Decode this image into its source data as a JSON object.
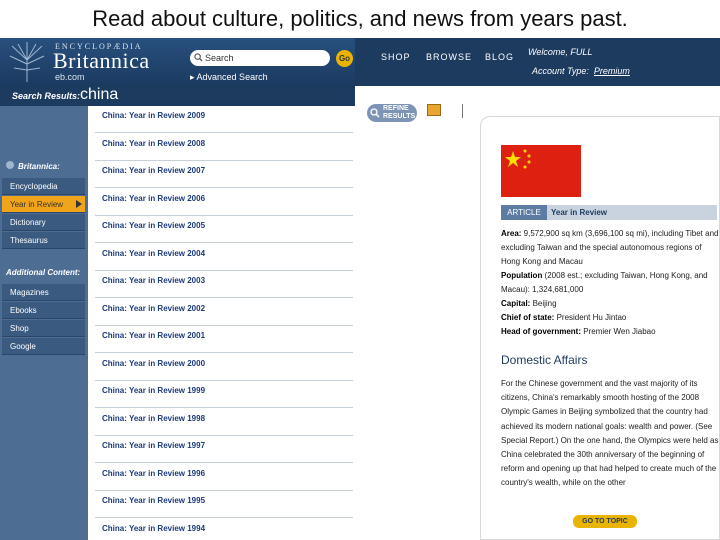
{
  "slide_title": "Read about culture, politics, and news from years past.",
  "header": {
    "logo_small": "ENCYCLOPÆDIA",
    "logo_big": "Britannica",
    "logo_eb": "eb.com",
    "search_placeholder": "Search",
    "go_label": "Go",
    "advanced_search": "Advanced Search",
    "nav": [
      "SHOP",
      "BROWSE",
      "BLOG"
    ],
    "welcome": "Welcome, FULL",
    "account_label": "Account Type:",
    "account_value": "Premium"
  },
  "results": {
    "label": "Search Results:",
    "query": "china"
  },
  "sidebar": {
    "britannica_head": "Britannica:",
    "items": [
      "Encyclopedia",
      "Year in Review",
      "Dictionary",
      "Thesaurus"
    ],
    "additional_head": "Additional Content:",
    "extra_items": [
      "Magazines",
      "Ebooks",
      "Shop",
      "Google"
    ]
  },
  "result_list": [
    "China: Year in Review 2009",
    "China: Year in Review 2008",
    "China: Year in Review 2007",
    "China: Year in Review 2006",
    "China: Year in Review 2005",
    "China: Year in Review 2004",
    "China: Year in Review 2003",
    "China: Year in Review 2002",
    "China: Year in Review 2001",
    "China: Year in Review 2000",
    "China: Year in Review 1999",
    "China: Year in Review 1998",
    "China: Year in Review 1997",
    "China: Year in Review 1996",
    "China: Year in Review 1995",
    "China: Year in Review 1994"
  ],
  "refine_label": "REFINE RESULTS",
  "article": {
    "tab_article": "ARTICLE",
    "tab_year": "Year in Review",
    "facts": [
      {
        "label": "Area:",
        "text": " 9,572,900 sq km (3,696,100 sq mi), including Tibet and excluding Taiwan and the special autonomous regions of Hong Kong and Macau"
      },
      {
        "label": "Population",
        "text": " (2008 est.; excluding Taiwan, Hong Kong, and Macau): 1,324,681,000"
      },
      {
        "label": "Capital:",
        "text": " Beijing"
      },
      {
        "label": "Chief of state:",
        "text": " President Hu Jintao"
      },
      {
        "label": "Head of government:",
        "text": " Premier Wen Jiabao"
      }
    ],
    "section_heading": "Domestic Affairs",
    "body": "For the Chinese government and the vast majority of its citizens, China's remarkably smooth hosting of the 2008 Olympic Games in Beijing symbolized that the country had achieved its modern national goals: wealth and power. (See Special Report.) On the one hand, the Olympics were held as China celebrated the 30th anniversary of the beginning of reform and opening up that had helped to create much of the country's wealth, while on the other",
    "goto_label": "GO TO TOPIC"
  },
  "colors": {
    "header": "#1d3a5f",
    "sidebar": "#4d6d93",
    "active": "#f0a41a",
    "flag": "#de2010"
  }
}
